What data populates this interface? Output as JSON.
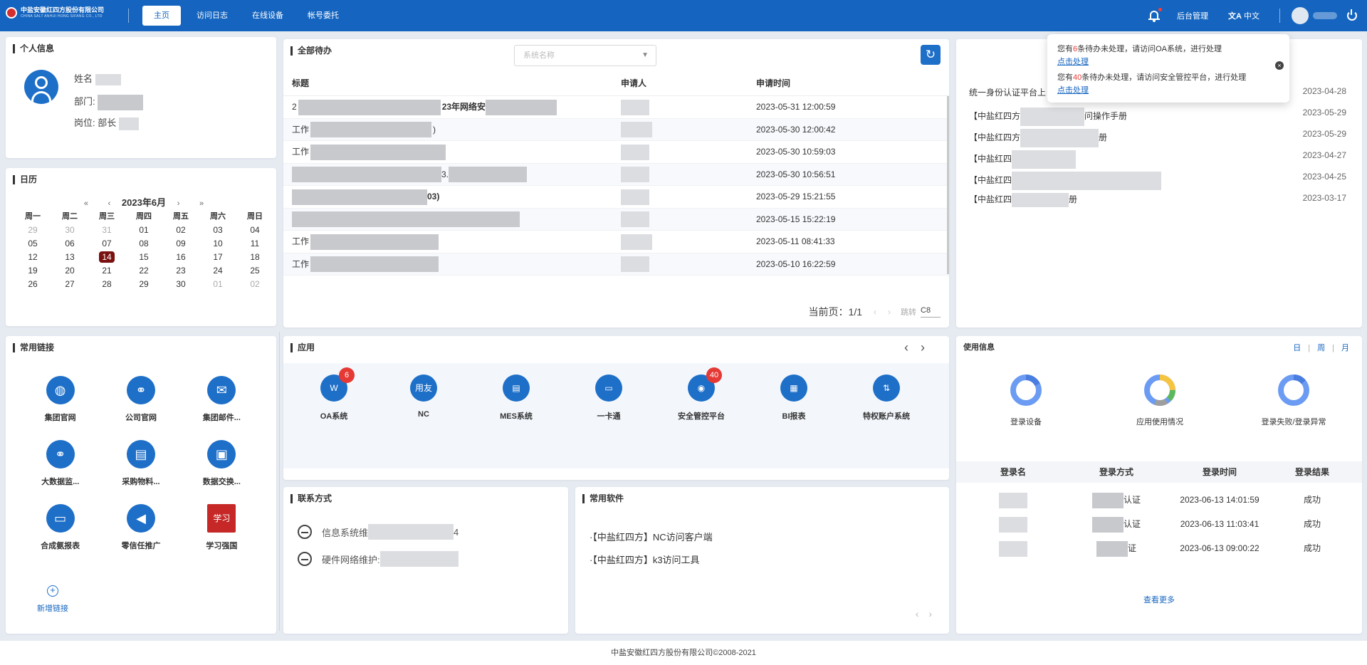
{
  "header": {
    "company_cn": "中盐安徽红四方股份有限公司",
    "company_en": "CHINA SALT ANHUI HONG SIFANG CO., LTD",
    "nav": [
      "主页",
      "访问日志",
      "在线设备",
      "帐号委托"
    ],
    "admin_label": "后台管理",
    "lang_label": "中文"
  },
  "personal": {
    "title": "个人信息",
    "name_label": "姓名",
    "dept_label": "部门: ",
    "dept_value": "",
    "post_label": "岗位: ",
    "post_value": "部长"
  },
  "calendar": {
    "title": "日历",
    "month_label": "2023年6月",
    "prev_year": "«",
    "prev_month": "‹",
    "next_month": "›",
    "next_year": "»",
    "weekdays": [
      "周一",
      "周二",
      "周三",
      "周四",
      "周五",
      "周六",
      "周日"
    ],
    "days": [
      [
        "29",
        "30",
        "31",
        "01",
        "02",
        "03",
        "04"
      ],
      [
        "05",
        "06",
        "07",
        "08",
        "09",
        "10",
        "11"
      ],
      [
        "12",
        "13",
        "14",
        "15",
        "16",
        "17",
        "18"
      ],
      [
        "19",
        "20",
        "21",
        "22",
        "23",
        "24",
        "25"
      ],
      [
        "26",
        "27",
        "28",
        "29",
        "30",
        "01",
        "02"
      ]
    ],
    "today": "14"
  },
  "links": {
    "title": "常用链接",
    "items": [
      {
        "label": "集团官网",
        "icon": "globe-icon"
      },
      {
        "label": "公司官网",
        "icon": "link-icon"
      },
      {
        "label": "集团邮件...",
        "icon": "mail-icon"
      },
      {
        "label": "大数据监...",
        "icon": "link-icon"
      },
      {
        "label": "采购物料...",
        "icon": "document-icon"
      },
      {
        "label": "数据交换...",
        "icon": "exchange-icon"
      },
      {
        "label": "合成氨报表",
        "icon": "chat-icon"
      },
      {
        "label": "零信任推广",
        "icon": "megaphone-icon"
      },
      {
        "label": "学习强国",
        "icon": "xuexi-logo-icon"
      }
    ],
    "add_label": "新增链接"
  },
  "todo": {
    "title": "全部待办",
    "select_placeholder": "系统名称",
    "columns": [
      "标题",
      "申请人",
      "申请时间"
    ],
    "rows": [
      {
        "title": "2",
        "title_mid": "23年网络安",
        "applicant": "",
        "time": "2023-05-31 12:00:59"
      },
      {
        "title": "工作",
        "title_mid": ")",
        "applicant": "",
        "time": "2023-05-30 12:00:42"
      },
      {
        "title": "工作",
        "title_mid": "",
        "applicant": "",
        "time": "2023-05-30 10:59:03"
      },
      {
        "title": "",
        "title_mid": "3.",
        "applicant": "",
        "time": "2023-05-30 10:56:51"
      },
      {
        "title": "",
        "title_mid": "03)",
        "applicant": "",
        "time": "2023-05-29 15:21:55"
      },
      {
        "title": "",
        "title_mid": "",
        "applicant": "",
        "time": "2023-05-15 15:22:19"
      },
      {
        "title": "工作",
        "title_mid": "",
        "applicant": "",
        "time": "2023-05-11 08:41:33"
      },
      {
        "title": "工作",
        "title_mid": "",
        "applicant": "",
        "time": "2023-05-10 16:22:59"
      }
    ],
    "pager_label": "当前页：1/1",
    "jump_label": "跳转",
    "jump_value": "C8"
  },
  "notices": {
    "rows": [
      {
        "text": "统一身份认证平台上",
        "date": "2023-04-28"
      },
      {
        "text": "【中盐红四方",
        "tail": "问操作手册",
        "date": "2023-05-29"
      },
      {
        "text": "【中盐红四方",
        "tail": "册",
        "date": "2023-05-29"
      },
      {
        "text": "【中盐红四",
        "tail": "",
        "date": "2023-04-27"
      },
      {
        "text": "【中盐红四",
        "tail": "",
        "date": "2023-04-25"
      },
      {
        "text": "【中盐红四",
        "tail": "册",
        "date": "2023-03-17"
      }
    ]
  },
  "notification": {
    "line1_prefix": "您有",
    "line1_count": "6",
    "line1_suffix": "条待办未处理，请访问OA系统，进行处理",
    "line2_prefix": "您有",
    "line2_count": "40",
    "line2_suffix": "条待办未处理，请访问安全管控平台，进行处理",
    "link_label": "点击处理"
  },
  "apps": {
    "title": "应用",
    "items": [
      {
        "label": "OA系统",
        "icon": "oa-icon",
        "badge": "6"
      },
      {
        "label": "NC",
        "icon": "nc-icon",
        "badge": ""
      },
      {
        "label": "MES系统",
        "icon": "mes-icon",
        "badge": ""
      },
      {
        "label": "一卡通",
        "icon": "card-icon",
        "badge": ""
      },
      {
        "label": "安全管控平台",
        "icon": "security-icon",
        "badge": "40"
      },
      {
        "label": "BI报表",
        "icon": "bi-icon",
        "badge": ""
      },
      {
        "label": "特权账户系统",
        "icon": "privilege-icon",
        "badge": ""
      }
    ]
  },
  "contact": {
    "title": "联系方式",
    "rows": [
      {
        "label": "信息系统维",
        "suffix": "4"
      },
      {
        "label": "硬件网络维护: ",
        "suffix": ""
      }
    ]
  },
  "software": {
    "title": "常用软件",
    "items": [
      "·【中盐红四方】NC访问客户端",
      "·【中盐红四方】k3访问工具"
    ]
  },
  "usage": {
    "title": "使用信息",
    "tabs": [
      "日",
      "周",
      "月"
    ],
    "donuts": [
      {
        "label": "登录设备",
        "colors": [
          "#6b9bf2",
          "#4a7de0"
        ]
      },
      {
        "label": "应用使用情况",
        "colors": [
          "#6b9bf2",
          "#f5c542",
          "#5cb85c",
          "#9e9e9e"
        ]
      },
      {
        "label": "登录失败/登录异常",
        "colors": [
          "#6b9bf2",
          "#4a7de0"
        ]
      }
    ],
    "columns": [
      "登录名",
      "登录方式",
      "登录时间",
      "登录结果"
    ],
    "rows": [
      {
        "method": "认证",
        "time": "2023-06-13 14:01:59",
        "result": "成功"
      },
      {
        "method": "认证",
        "time": "2023-06-13 11:03:41",
        "result": "成功"
      },
      {
        "method": "证",
        "time": "2023-06-13 09:00:22",
        "result": "成功"
      }
    ],
    "more_label": "查看更多"
  },
  "footer": {
    "text": "中盐安徽红四方股份有限公司©2008-2021"
  }
}
